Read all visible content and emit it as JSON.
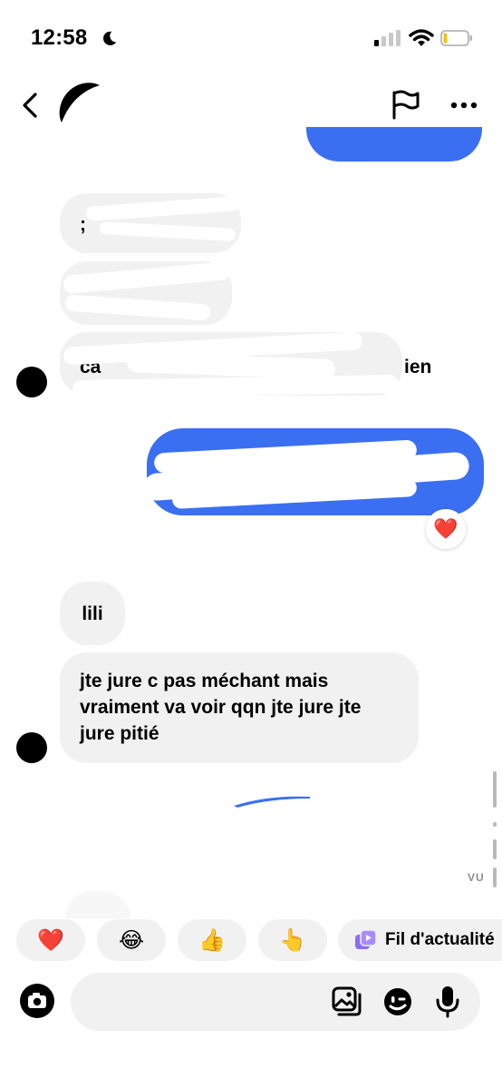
{
  "status_bar": {
    "time": "12:58",
    "battery_level": 0.12
  },
  "header": {
    "icons": [
      "chevron-left-icon",
      "flag-icon",
      "more-icon"
    ]
  },
  "messages": {
    "partial_1": ";",
    "partial_2": "ca",
    "partial_2_end": "ien",
    "msg_lili": "lili",
    "msg_long": "jte jure c pas méchant mais vraiment va voir qqn jte jure jte jure pitié"
  },
  "reaction": {
    "emoji": "❤️"
  },
  "seen_label": "VU",
  "quick_replies": [
    {
      "name": "heart",
      "emoji": "❤️"
    },
    {
      "name": "laughing",
      "emoji": "😂"
    },
    {
      "name": "thumbs-up",
      "emoji": "👍"
    },
    {
      "name": "pointing",
      "emoji": "👆"
    }
  ],
  "feed_chip": {
    "label": "Fil d'actualité"
  },
  "composer": {
    "placeholder": ""
  },
  "colors": {
    "accent_blue": "#3b6ff2",
    "bubble_gray": "#f1f1f1",
    "heart_red": "#e0282e"
  }
}
